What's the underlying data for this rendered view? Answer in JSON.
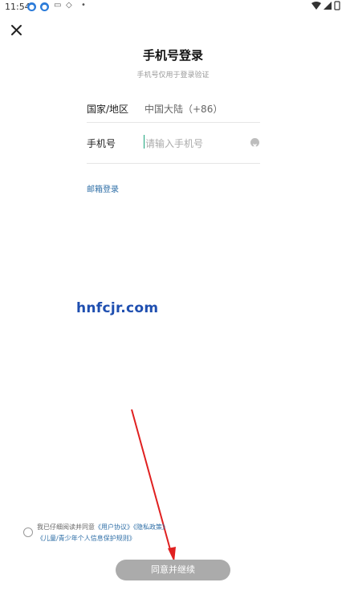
{
  "status_bar": {
    "time": "11:54",
    "icons_left": [
      "notification-icon",
      "notification-icon",
      "controller-icon",
      "cube-icon",
      "dot"
    ],
    "icons_right": [
      "wifi-icon",
      "signal-icon",
      "battery-icon"
    ]
  },
  "header": {
    "close_icon": "close-icon",
    "title": "手机号登录",
    "subtitle": "手机号仅用于登录验证"
  },
  "form": {
    "region_label": "国家/地区",
    "region_value": "中国大陆（+86）",
    "phone_label": "手机号",
    "phone_placeholder": "请输入手机号",
    "phone_value": ""
  },
  "email_login_link": "邮箱登录",
  "watermark": "hnfcjr.com",
  "agreement": {
    "prefix": "我已仔细阅读并同意",
    "user_agreement": "《用户协议》",
    "privacy_policy": "《隐私政策》",
    "child_policy": "《儿童/青少年个人信息保护规则》",
    "checked": false
  },
  "continue_button": "同意并继续",
  "colors": {
    "link": "#2f6fa7",
    "button_disabled": "#ababab",
    "cursor": "#1aa37a",
    "annotation_arrow": "#e02020"
  }
}
